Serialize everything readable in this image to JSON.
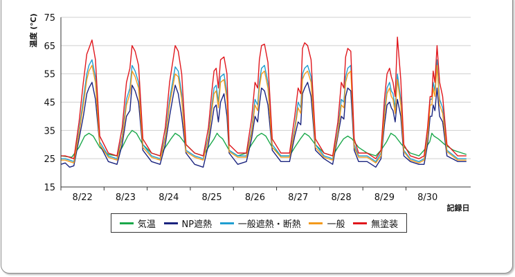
{
  "chart_data": {
    "type": "line",
    "ylabel": "温度 (℃)",
    "xlabel": "記録日",
    "ylim": [
      15,
      75
    ],
    "yticks": [
      15,
      25,
      35,
      45,
      55,
      65,
      75
    ],
    "xlim": [
      0,
      9.5
    ],
    "day_labels": [
      "8/22",
      "8/23",
      "8/24",
      "8/25",
      "8/26",
      "8/27",
      "8/28",
      "8/29",
      "8/30"
    ],
    "grid": "horizontal",
    "series": [
      {
        "name": "気温",
        "color": "#1aa84a",
        "x": [
          0,
          0.25,
          0.42,
          0.55,
          0.65,
          0.75,
          0.9,
          1.1,
          1.3,
          1.42,
          1.55,
          1.65,
          1.75,
          1.9,
          2.1,
          2.3,
          2.42,
          2.55,
          2.65,
          2.75,
          2.9,
          3.1,
          3.3,
          3.42,
          3.55,
          3.62,
          3.67,
          3.75,
          3.9,
          4.1,
          4.3,
          4.42,
          4.55,
          4.65,
          4.75,
          4.9,
          5.1,
          5.3,
          5.42,
          5.55,
          5.65,
          5.75,
          5.9,
          6.1,
          6.3,
          6.42,
          6.55,
          6.65,
          6.75,
          6.9,
          7.1,
          7.3,
          7.42,
          7.55,
          7.65,
          7.75,
          7.9,
          8.1,
          8.3,
          8.42,
          8.55,
          8.6,
          8.65,
          8.75,
          8.9,
          9.1,
          9.3,
          9.4
        ],
        "y": [
          26,
          25.5,
          29,
          33,
          34,
          33,
          29,
          26.5,
          26,
          29,
          33,
          35,
          34,
          30,
          27,
          26,
          29,
          32,
          34,
          33,
          30,
          27,
          26,
          29,
          32,
          34,
          33,
          32,
          28,
          26,
          27,
          30,
          33,
          34,
          33,
          29,
          26,
          26,
          29,
          32,
          34,
          33,
          30,
          27,
          26,
          29,
          32,
          33,
          32,
          29,
          27,
          26,
          28,
          31,
          34,
          33,
          30,
          27,
          26,
          28,
          31,
          34,
          33,
          32,
          30,
          28,
          27,
          26.5
        ]
      },
      {
        "name": "NP遮熱",
        "color": "#1a237e",
        "x": [
          0,
          0.1,
          0.2,
          0.3,
          0.42,
          0.52,
          0.6,
          0.65,
          0.72,
          0.8,
          0.9,
          1.1,
          1.3,
          1.42,
          1.52,
          1.6,
          1.65,
          1.72,
          1.8,
          1.9,
          2.1,
          2.3,
          2.42,
          2.52,
          2.6,
          2.65,
          2.72,
          2.8,
          2.9,
          3.1,
          3.3,
          3.42,
          3.5,
          3.55,
          3.6,
          3.65,
          3.7,
          3.78,
          3.85,
          3.9,
          4.1,
          4.3,
          4.42,
          4.5,
          4.56,
          4.6,
          4.65,
          4.72,
          4.8,
          4.9,
          5.1,
          5.3,
          5.42,
          5.5,
          5.56,
          5.6,
          5.65,
          5.72,
          5.8,
          5.9,
          6.1,
          6.3,
          6.42,
          6.5,
          6.56,
          6.6,
          6.65,
          6.72,
          6.8,
          6.9,
          7.1,
          7.3,
          7.42,
          7.5,
          7.56,
          7.62,
          7.66,
          7.7,
          7.75,
          7.8,
          7.88,
          7.95,
          8.1,
          8.3,
          8.42,
          8.5,
          8.56,
          8.6,
          8.63,
          8.67,
          8.72,
          8.78,
          8.85,
          8.95,
          9.2,
          9.4
        ],
        "y": [
          23,
          23.5,
          22,
          22.5,
          32,
          40,
          48,
          50,
          52,
          46,
          30,
          24,
          23,
          30,
          40,
          42,
          51,
          49,
          45,
          28,
          24,
          23,
          30,
          40,
          47,
          51,
          48,
          40,
          27,
          23,
          22,
          30,
          38,
          43,
          44,
          38,
          45,
          48,
          40,
          27,
          23,
          24,
          32,
          40,
          38,
          44,
          50,
          49,
          44,
          28,
          24,
          24,
          33,
          38,
          37,
          48,
          50,
          52,
          47,
          28,
          25,
          23,
          33,
          40,
          39,
          47,
          50,
          49,
          28,
          24,
          24,
          22,
          25,
          37,
          44,
          45,
          43,
          42,
          38,
          46,
          40,
          26,
          24,
          23,
          23,
          30,
          40,
          40,
          44,
          42,
          50,
          40,
          38,
          26,
          24,
          24
        ]
      },
      {
        "name": "一般遮熱・断熱",
        "color": "#1f9ed1",
        "x": [
          0,
          0.1,
          0.2,
          0.3,
          0.42,
          0.52,
          0.6,
          0.65,
          0.72,
          0.8,
          0.9,
          1.1,
          1.3,
          1.42,
          1.52,
          1.6,
          1.65,
          1.72,
          1.8,
          1.9,
          2.1,
          2.3,
          2.42,
          2.52,
          2.6,
          2.65,
          2.72,
          2.8,
          2.9,
          3.1,
          3.3,
          3.42,
          3.5,
          3.55,
          3.6,
          3.65,
          3.7,
          3.78,
          3.85,
          3.9,
          4.1,
          4.3,
          4.42,
          4.5,
          4.56,
          4.6,
          4.65,
          4.72,
          4.8,
          4.9,
          5.1,
          5.3,
          5.42,
          5.5,
          5.56,
          5.6,
          5.65,
          5.72,
          5.8,
          5.9,
          6.1,
          6.3,
          6.42,
          6.5,
          6.56,
          6.6,
          6.65,
          6.72,
          6.8,
          6.9,
          7.1,
          7.3,
          7.42,
          7.5,
          7.56,
          7.62,
          7.66,
          7.7,
          7.75,
          7.8,
          7.88,
          7.95,
          8.1,
          8.3,
          8.42,
          8.5,
          8.56,
          8.6,
          8.63,
          8.67,
          8.72,
          8.78,
          8.85,
          8.95,
          9.2,
          9.4
        ],
        "y": [
          25,
          25,
          24.5,
          24,
          35,
          46,
          55,
          58,
          60,
          54,
          31,
          26,
          25,
          33,
          46,
          50,
          58,
          56,
          52,
          30,
          26,
          25,
          33,
          46,
          53,
          57.5,
          56,
          48,
          28,
          26,
          25,
          33,
          44,
          50,
          51,
          45,
          54,
          55,
          48,
          28,
          26,
          26,
          35,
          46,
          44,
          52,
          57,
          58,
          52,
          30,
          26,
          26,
          36,
          45,
          43,
          55,
          57,
          58,
          54,
          30,
          26,
          25,
          35,
          46,
          45,
          54,
          57,
          58,
          30,
          26,
          26,
          24,
          27,
          42,
          50,
          52,
          49,
          48,
          43,
          55,
          46,
          28,
          25,
          24,
          25,
          33,
          46,
          46,
          52,
          49,
          60,
          46,
          43,
          28,
          25,
          25
        ]
      },
      {
        "name": "一般",
        "color": "#f39a1c",
        "x": [
          0,
          0.1,
          0.2,
          0.3,
          0.42,
          0.52,
          0.6,
          0.65,
          0.72,
          0.8,
          0.9,
          1.1,
          1.3,
          1.42,
          1.52,
          1.6,
          1.65,
          1.72,
          1.8,
          1.9,
          2.1,
          2.3,
          2.42,
          2.52,
          2.6,
          2.65,
          2.72,
          2.8,
          2.9,
          3.1,
          3.3,
          3.42,
          3.5,
          3.55,
          3.6,
          3.65,
          3.7,
          3.78,
          3.85,
          3.9,
          4.1,
          4.3,
          4.42,
          4.5,
          4.56,
          4.6,
          4.65,
          4.72,
          4.8,
          4.9,
          5.1,
          5.3,
          5.42,
          5.5,
          5.56,
          5.6,
          5.65,
          5.72,
          5.8,
          5.9,
          6.1,
          6.3,
          6.42,
          6.5,
          6.56,
          6.6,
          6.65,
          6.72,
          6.8,
          6.9,
          7.1,
          7.3,
          7.42,
          7.5,
          7.56,
          7.62,
          7.66,
          7.7,
          7.75,
          7.8,
          7.88,
          7.95,
          8.1,
          8.3,
          8.42,
          8.5,
          8.56,
          8.6,
          8.63,
          8.67,
          8.72,
          8.78,
          8.85,
          8.95,
          9.2,
          9.4
        ],
        "y": [
          24.5,
          24.5,
          24,
          23.5,
          34,
          44,
          53,
          56,
          58,
          52,
          30,
          25.5,
          24.5,
          32,
          44,
          48,
          56,
          54,
          50,
          29,
          25.5,
          24.5,
          32,
          44,
          51,
          55,
          54,
          46,
          27.5,
          25.5,
          24.5,
          32,
          42,
          48,
          49,
          43,
          52,
          53,
          46,
          27.5,
          25.5,
          25.5,
          34,
          44,
          42,
          50,
          55,
          56,
          50,
          29,
          25.5,
          25.5,
          35,
          43,
          41,
          53,
          55,
          56,
          52,
          29,
          25.5,
          24.5,
          34,
          44,
          43,
          52,
          55,
          56,
          29,
          25.5,
          25.5,
          23.5,
          26,
          40,
          48,
          50,
          47,
          46,
          41,
          53,
          44,
          27.5,
          24.5,
          23.5,
          24.5,
          32,
          44,
          44,
          50,
          47,
          58,
          44,
          41,
          27.5,
          24.5,
          24.5
        ]
      },
      {
        "name": "無塗装",
        "color": "#e0161c",
        "x": [
          0,
          0.1,
          0.2,
          0.3,
          0.42,
          0.52,
          0.6,
          0.65,
          0.72,
          0.8,
          0.9,
          1.1,
          1.3,
          1.42,
          1.52,
          1.6,
          1.65,
          1.72,
          1.8,
          1.9,
          2.1,
          2.3,
          2.42,
          2.52,
          2.6,
          2.65,
          2.72,
          2.8,
          2.9,
          3.1,
          3.3,
          3.42,
          3.5,
          3.55,
          3.6,
          3.65,
          3.7,
          3.78,
          3.85,
          3.9,
          4.1,
          4.3,
          4.42,
          4.5,
          4.56,
          4.6,
          4.65,
          4.72,
          4.8,
          4.9,
          5.1,
          5.3,
          5.42,
          5.5,
          5.56,
          5.6,
          5.65,
          5.72,
          5.8,
          5.9,
          6.1,
          6.3,
          6.42,
          6.5,
          6.56,
          6.6,
          6.65,
          6.72,
          6.8,
          6.9,
          7.1,
          7.3,
          7.42,
          7.5,
          7.56,
          7.62,
          7.66,
          7.7,
          7.75,
          7.8,
          7.88,
          7.95,
          8.1,
          8.3,
          8.42,
          8.5,
          8.56,
          8.6,
          8.63,
          8.67,
          8.72,
          8.78,
          8.85,
          8.95,
          9.2,
          9.4
        ],
        "y": [
          26,
          26,
          25.5,
          25,
          38,
          52,
          62,
          64,
          67,
          60,
          33,
          27,
          26,
          36,
          52,
          57,
          65,
          63,
          58,
          32,
          27,
          26,
          36,
          52,
          60,
          65,
          63,
          55,
          30,
          27,
          26,
          36,
          49,
          56,
          57,
          50,
          60,
          61,
          55,
          30,
          27,
          27,
          39,
          52,
          50,
          60,
          65,
          65.5,
          59,
          32,
          27,
          27,
          40,
          50,
          48,
          64,
          66,
          65,
          60,
          32,
          27,
          26,
          38,
          52,
          50,
          61,
          64,
          63,
          32,
          27,
          27,
          25,
          28,
          46,
          55,
          57,
          54,
          52,
          47,
          68,
          53,
          30,
          26,
          25,
          26,
          36,
          47,
          47,
          56,
          52,
          65,
          52,
          47,
          30,
          26,
          26
        ]
      }
    ]
  }
}
